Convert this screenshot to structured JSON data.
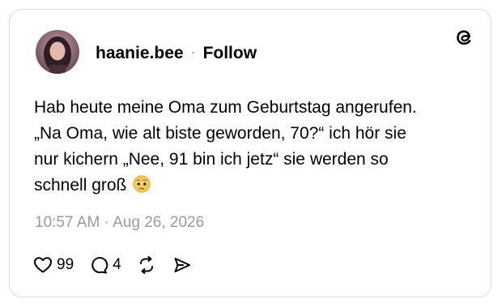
{
  "post": {
    "username": "haanie.bee",
    "separator": "·",
    "follow_label": "Follow",
    "text": "Hab heute meine Oma zum Geburtstag angerufen.\n„Na Oma, wie alt biste geworden, 70?“ ich hör sie\nnur kichern „Nee, 91 bin ich jetz“ sie werden so\nschnell groß",
    "emoji": "pleading-face-emoji",
    "timestamp": "10:57 AM · Aug 26, 2026"
  },
  "actions": {
    "like_count": "99",
    "reply_count": "4",
    "like_icon": "heart-icon",
    "reply_icon": "comment-icon",
    "repost_icon": "repost-icon",
    "share_icon": "share-icon"
  },
  "brand": {
    "logo": "threads-logo-icon"
  },
  "colors": {
    "text": "#000000",
    "muted": "#9a9a9a",
    "border": "#dcdcdc"
  }
}
